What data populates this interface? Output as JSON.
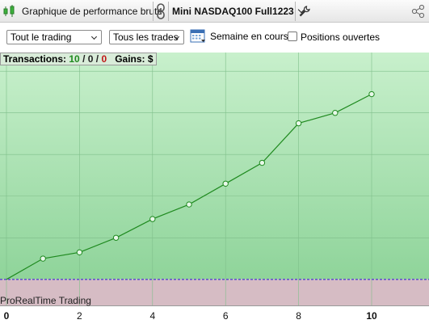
{
  "toolbar": {
    "title": "Graphique de performance brute",
    "instrument": "Mini NASDAQ100 Full1223"
  },
  "filters": {
    "mode": "Tout le trading",
    "trades": "Tous les trades",
    "period": "Semaine en cours",
    "open_positions": "Positions ouvertes"
  },
  "summary": {
    "transactions_label": "Transactions:",
    "count_total": "10",
    "count_neutral": "0",
    "count_loss": "0",
    "sep": "/",
    "gains_label": "Gains:",
    "gains_value": "$"
  },
  "watermark": "ProRealTime Trading",
  "colors": {
    "positive_zone": "#b3e6b8",
    "negative_zone": "#d6bcc4",
    "line": "#1f8a1f",
    "zero_line": "#5a3fd1"
  },
  "chart_data": {
    "type": "line",
    "title": "",
    "xlabel": "",
    "ylabel": "",
    "x": [
      0,
      1,
      2,
      3,
      4,
      5,
      6,
      7,
      8,
      9,
      10
    ],
    "y": [
      0,
      1,
      1.3,
      2,
      2.9,
      3.6,
      4.6,
      5.6,
      7.5,
      8,
      8.9
    ],
    "xticks": [
      "0",
      "2",
      "4",
      "6",
      "8",
      "10"
    ],
    "bold_ticks": [
      "0",
      "10"
    ],
    "xlim": [
      0,
      11.5
    ],
    "ylim": [
      -1.25,
      10.9
    ],
    "grid": true
  }
}
